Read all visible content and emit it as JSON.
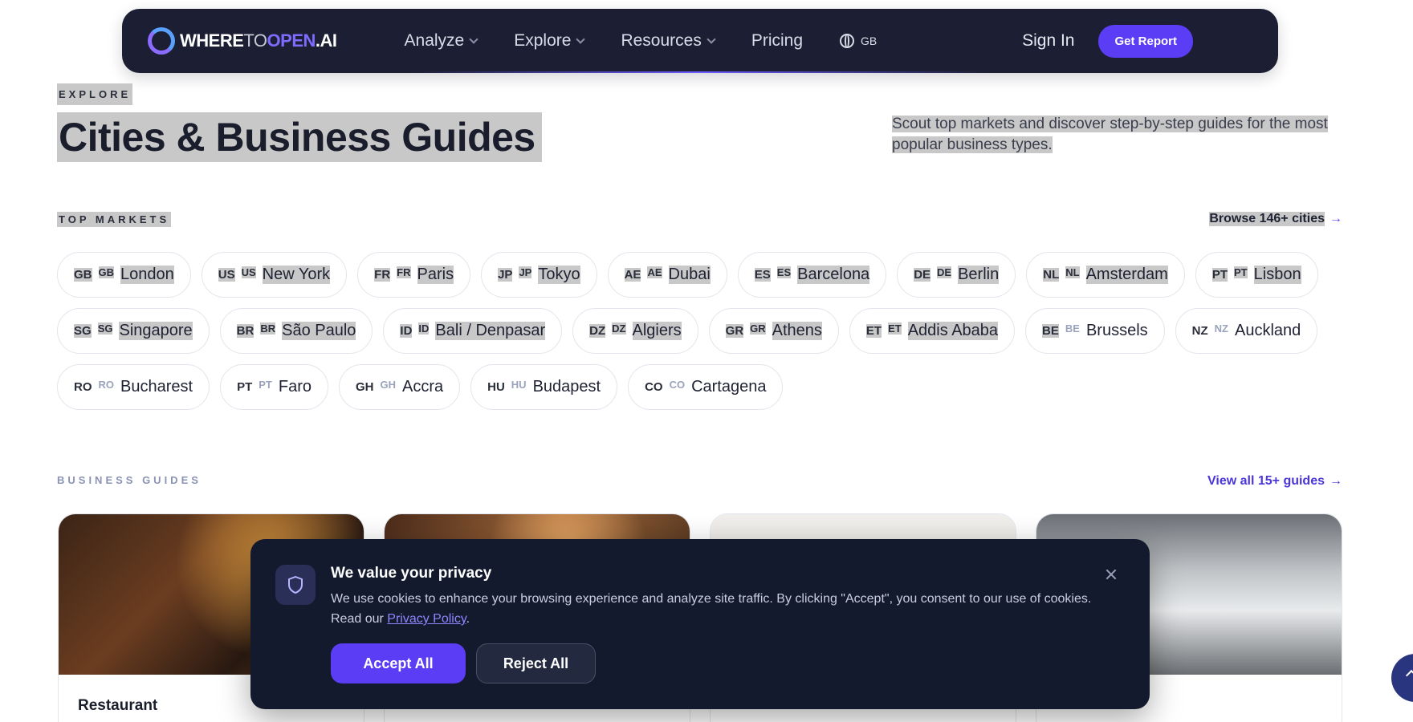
{
  "nav": {
    "logo": {
      "where": "WHERE",
      "to": "TO",
      "open": "OPEN",
      "ai": ".AI"
    },
    "links": [
      {
        "label": "Analyze",
        "dropdown": true
      },
      {
        "label": "Explore",
        "dropdown": true
      },
      {
        "label": "Resources",
        "dropdown": true
      },
      {
        "label": "Pricing",
        "dropdown": false
      }
    ],
    "lang": "GB",
    "signin": "Sign In",
    "cta": "Get Report"
  },
  "header": {
    "eyebrow": "EXPLORE",
    "title": "Cities & Business Guides",
    "subtitle": "Scout top markets and discover step-by-step guides for the most popular business types."
  },
  "markets": {
    "eyebrow": "TOP MARKETS",
    "browse": "Browse 146+ cities",
    "rows": [
      [
        {
          "code": "GB",
          "name": "London"
        },
        {
          "code": "US",
          "name": "New York"
        },
        {
          "code": "FR",
          "name": "Paris"
        },
        {
          "code": "JP",
          "name": "Tokyo"
        },
        {
          "code": "AE",
          "name": "Dubai"
        },
        {
          "code": "ES",
          "name": "Barcelona"
        },
        {
          "code": "DE",
          "name": "Berlin"
        },
        {
          "code": "NL",
          "name": "Amsterdam"
        },
        {
          "code": "PT",
          "name": "Lisbon"
        }
      ],
      [
        {
          "code": "SG",
          "name": "Singapore"
        },
        {
          "code": "BR",
          "name": "São Paulo"
        },
        {
          "code": "ID",
          "name": "Bali / Denpasar"
        },
        {
          "code": "DZ",
          "name": "Algiers"
        },
        {
          "code": "GR",
          "name": "Athens"
        },
        {
          "code": "ET",
          "name": "Addis Ababa"
        },
        {
          "code": "BE",
          "name": "Brussels"
        },
        {
          "code": "NZ",
          "name": "Auckland"
        }
      ],
      [
        {
          "code": "RO",
          "name": "Bucharest"
        },
        {
          "code": "PT",
          "name": "Faro"
        },
        {
          "code": "GH",
          "name": "Accra"
        },
        {
          "code": "HU",
          "name": "Budapest"
        },
        {
          "code": "CO",
          "name": "Cartagena"
        }
      ]
    ]
  },
  "guides": {
    "eyebrow": "BUSINESS GUIDES",
    "view_all": "View all 15+ guides",
    "cards": [
      {
        "title": "Restaurant",
        "image": "restaurant-photo"
      },
      {
        "title": "",
        "image": "bar-photo"
      },
      {
        "title": "",
        "image": "salon-photo"
      },
      {
        "title": "",
        "image": "gym-photo"
      }
    ]
  },
  "cookie": {
    "title": "We value your privacy",
    "text_before": "We use cookies to enhance your browsing experience and analyze site traffic. By clicking \"Accept\", you consent to our use of cookies. Read our ",
    "link": "Privacy Policy",
    "text_after": ".",
    "accept": "Accept All",
    "reject": "Reject All"
  },
  "colors": {
    "accent": "#5a3df5",
    "nav_bg": "#1c1f33",
    "banner_bg": "#141a2e"
  }
}
